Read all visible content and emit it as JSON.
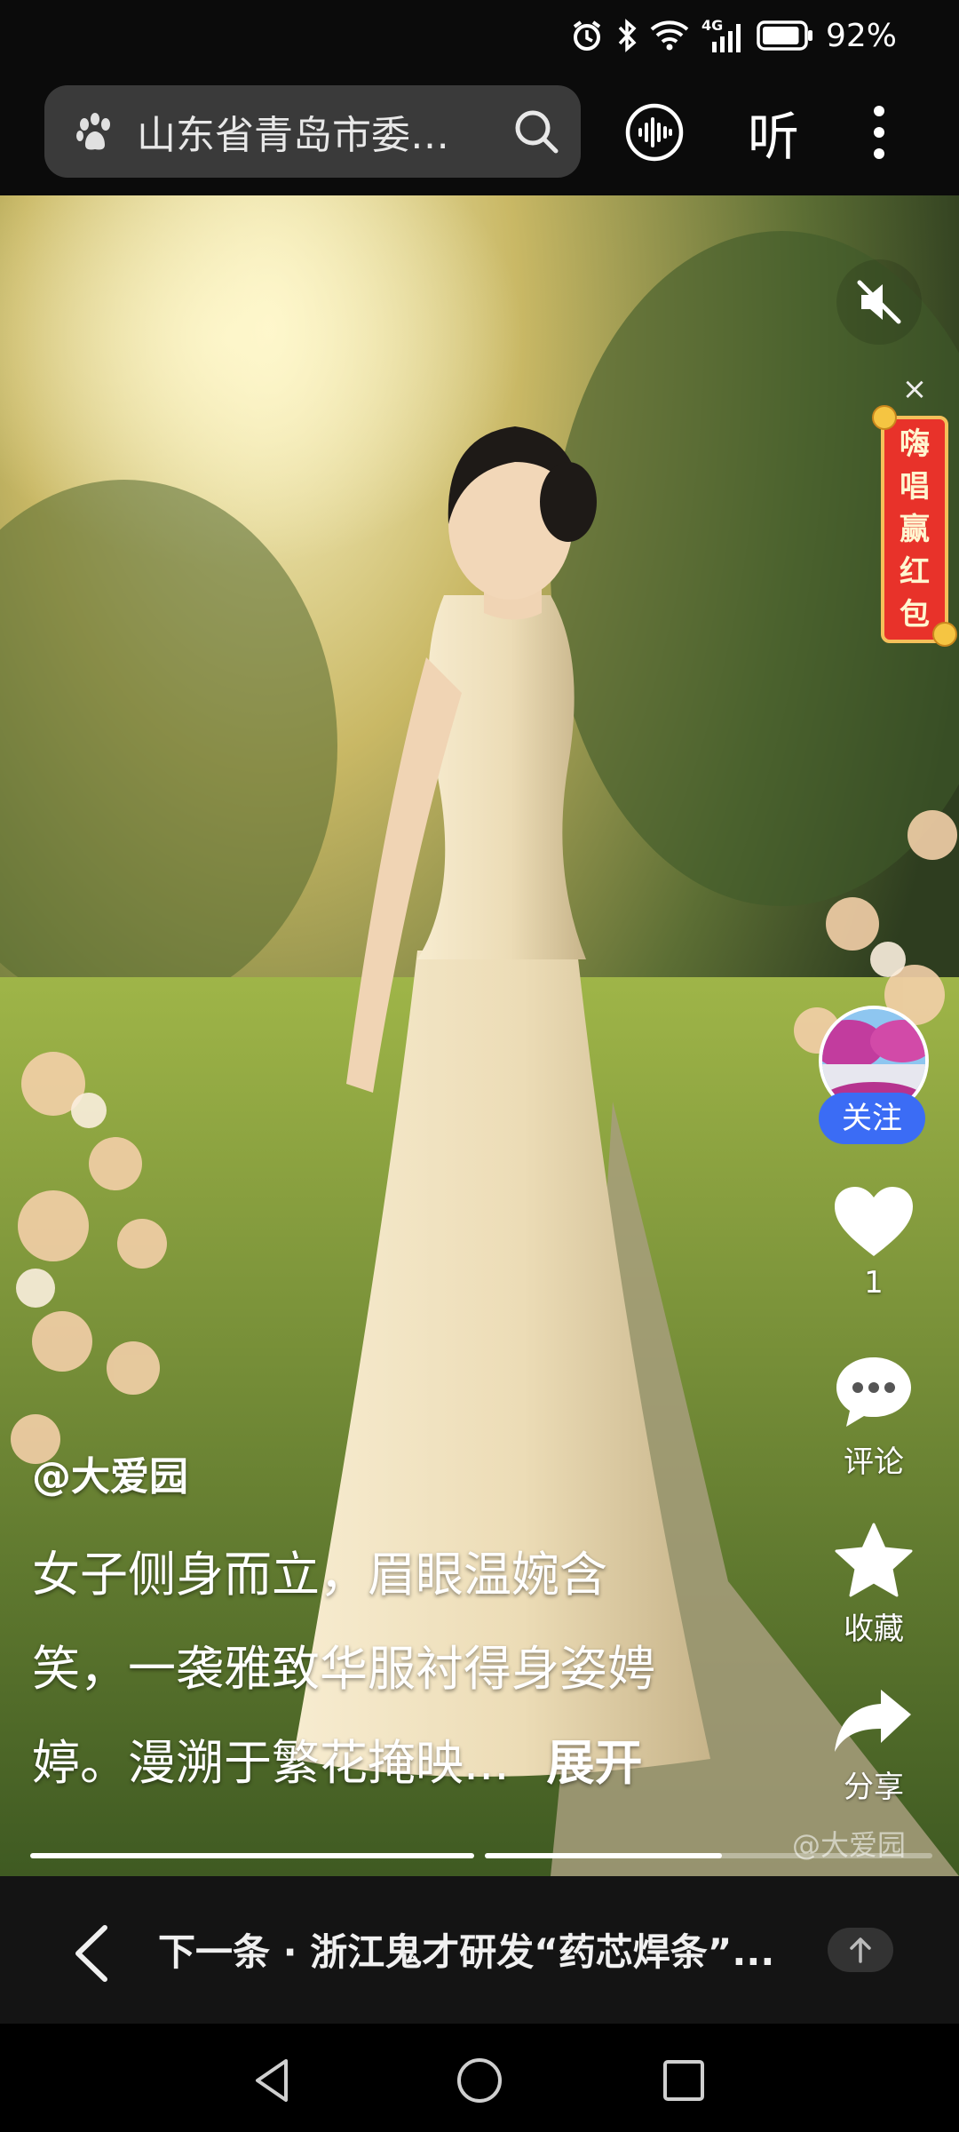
{
  "status_bar": {
    "battery_percent": "92%",
    "network": "4G",
    "battery_level": 0.92
  },
  "top_bar": {
    "search_text": "山东省青岛市委…",
    "listen_label": "听"
  },
  "promo": {
    "text": [
      "嗨",
      "唱",
      "赢",
      "红",
      "包"
    ],
    "close": "×"
  },
  "sidebar": {
    "follow_label": "关注",
    "like_count": "1",
    "comment_label": "评论",
    "collect_label": "收藏",
    "share_label": "分享"
  },
  "post": {
    "author": "@大爱园",
    "caption_lines": [
      "女子侧身而立，眉眼温婉含",
      "笑，一袭雅致华服衬得身姿娉",
      "婷。漫溯于繁花掩映..."
    ],
    "expand_label": "展开",
    "watermark": "@大爱园"
  },
  "progress": {
    "segments": 2,
    "current_segment": 2,
    "current_fraction": 0.53
  },
  "next_bar": {
    "text": "下一条 · 浙江鬼才研发“药芯焊条”..."
  },
  "colors": {
    "follow_button": "#3b6cf5",
    "promo_red": "#e8322a",
    "promo_gold": "#f5c05a"
  }
}
